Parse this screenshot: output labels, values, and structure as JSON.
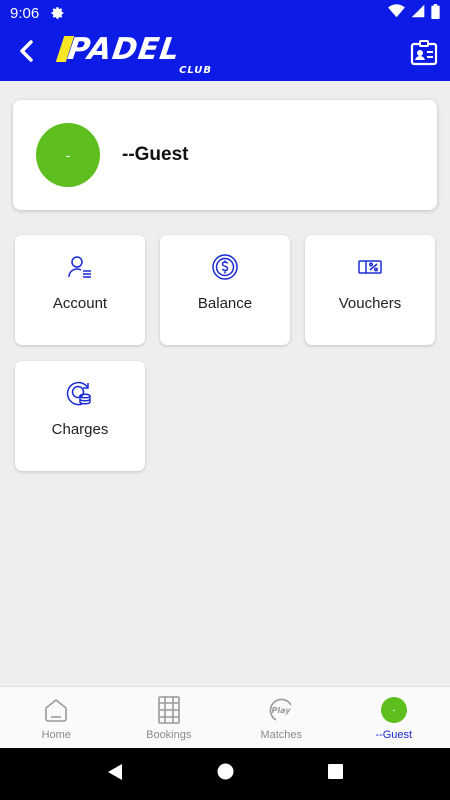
{
  "status_bar": {
    "time": "9:06"
  },
  "header": {
    "logo_main": "PADEL",
    "logo_sub": "CLUB",
    "back_icon": "chevron-left-icon",
    "profile_card_icon": "id-card-icon"
  },
  "profile": {
    "avatar_text": "-",
    "name": "--Guest"
  },
  "tiles": [
    {
      "label": "Account",
      "icon": "user-list-icon"
    },
    {
      "label": "Balance",
      "icon": "dollar-coin-icon"
    },
    {
      "label": "Vouchers",
      "icon": "voucher-percent-icon"
    },
    {
      "label": "Charges",
      "icon": "coins-refresh-icon"
    }
  ],
  "bottom_nav": [
    {
      "label": "Home",
      "icon": "home-icon",
      "active": false
    },
    {
      "label": "Bookings",
      "icon": "court-icon",
      "active": false
    },
    {
      "label": "Matches",
      "icon": "play-icon",
      "active": false
    },
    {
      "label": "--Guest",
      "icon": "avatar",
      "avatar_text": "-",
      "active": true
    }
  ],
  "colors": {
    "brand_blue": "#0d1be6",
    "accent_green": "#5dbe1e",
    "icon_blue": "#1a2bd6",
    "logo_yellow": "#f6e626"
  }
}
